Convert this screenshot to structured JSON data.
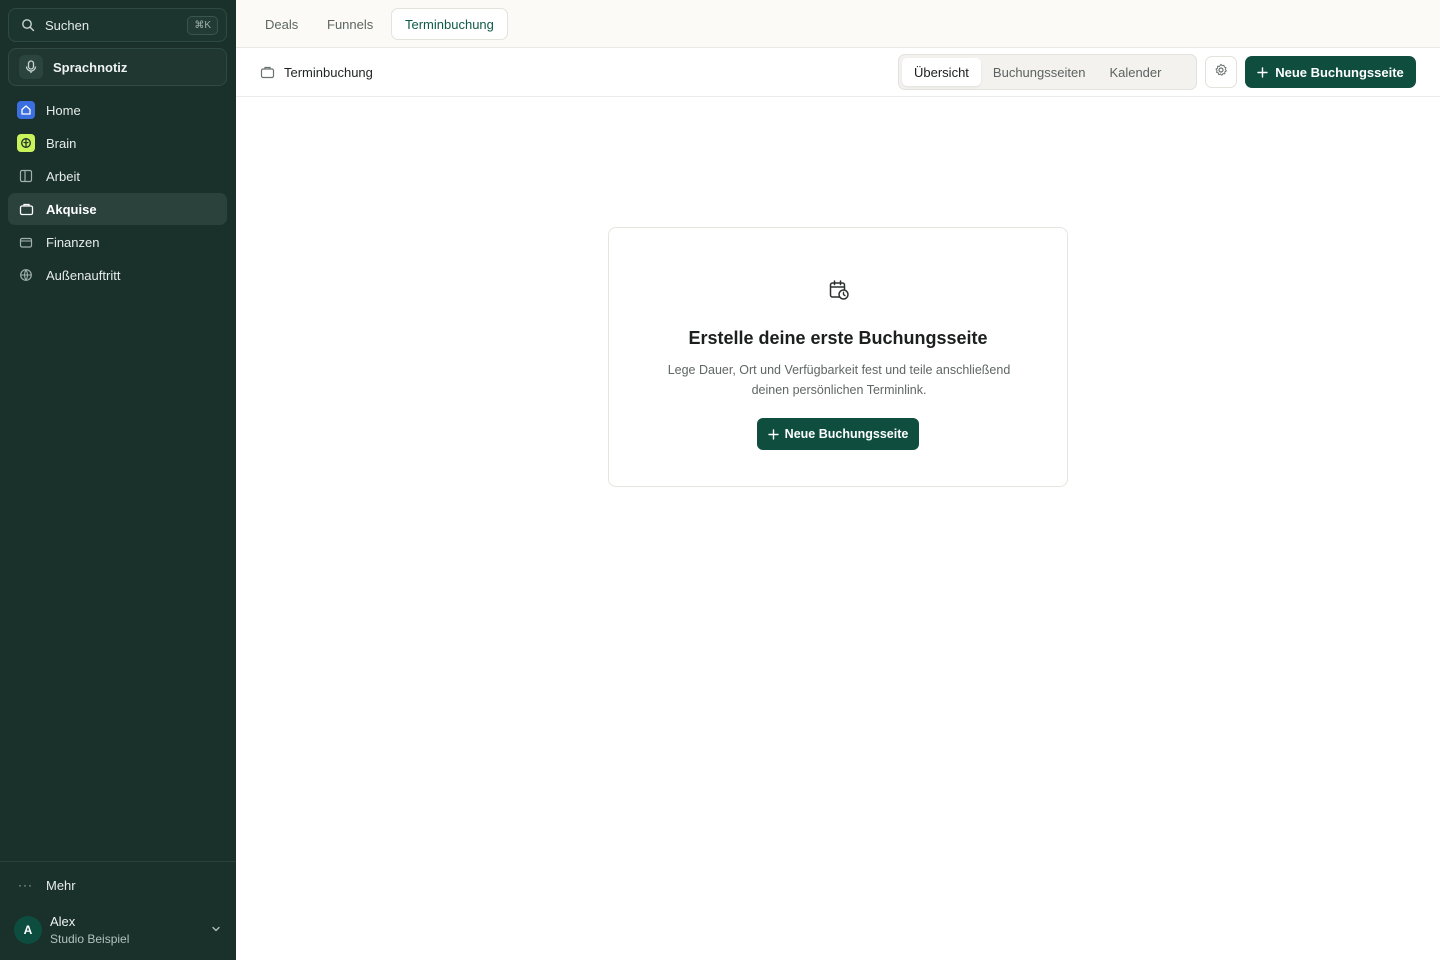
{
  "sidebar": {
    "search": {
      "label": "Suchen",
      "shortcut": "⌘K",
      "icon": "search-icon"
    },
    "voice_note": {
      "label": "Sprachnotiz",
      "icon": "mic-icon"
    },
    "items": [
      {
        "label": "Home",
        "icon": "home-icon",
        "active": false
      },
      {
        "label": "Brain",
        "icon": "brain-icon",
        "active": false
      },
      {
        "label": "Arbeit",
        "icon": "columns-icon",
        "active": false
      },
      {
        "label": "Akquise",
        "icon": "briefcase-icon",
        "active": true
      },
      {
        "label": "Finanzen",
        "icon": "wallet-icon",
        "active": false
      },
      {
        "label": "Außenauftritt",
        "icon": "globe-icon",
        "active": false
      }
    ],
    "more": {
      "label": "Mehr"
    },
    "user": {
      "initial": "A",
      "name": "Alex",
      "org": "Studio Beispiel"
    }
  },
  "tabs": [
    {
      "label": "Deals",
      "active": false
    },
    {
      "label": "Funnels",
      "active": false
    },
    {
      "label": "Terminbuchung",
      "active": true
    }
  ],
  "header": {
    "breadcrumb": "Terminbuchung",
    "segments": [
      {
        "label": "Übersicht",
        "active": true
      },
      {
        "label": "Buchungsseiten",
        "active": false
      },
      {
        "label": "Kalender",
        "active": false
      }
    ],
    "primary_button": "Neue Buchungsseite"
  },
  "empty_state": {
    "title": "Erstelle deine erste Buchungsseite",
    "description": "Lege Dauer, Ort und Verfügbarkeit fest und teile anschließend deinen persönlichen Terminlink.",
    "button": "Neue Buchungsseite"
  },
  "colors": {
    "sidebar_bg": "#1a302a",
    "primary": "#0f4d3f",
    "accent_tab": "#0f5a48",
    "home_badge": "#3b6fe0",
    "brain_badge": "#c8f35a"
  }
}
